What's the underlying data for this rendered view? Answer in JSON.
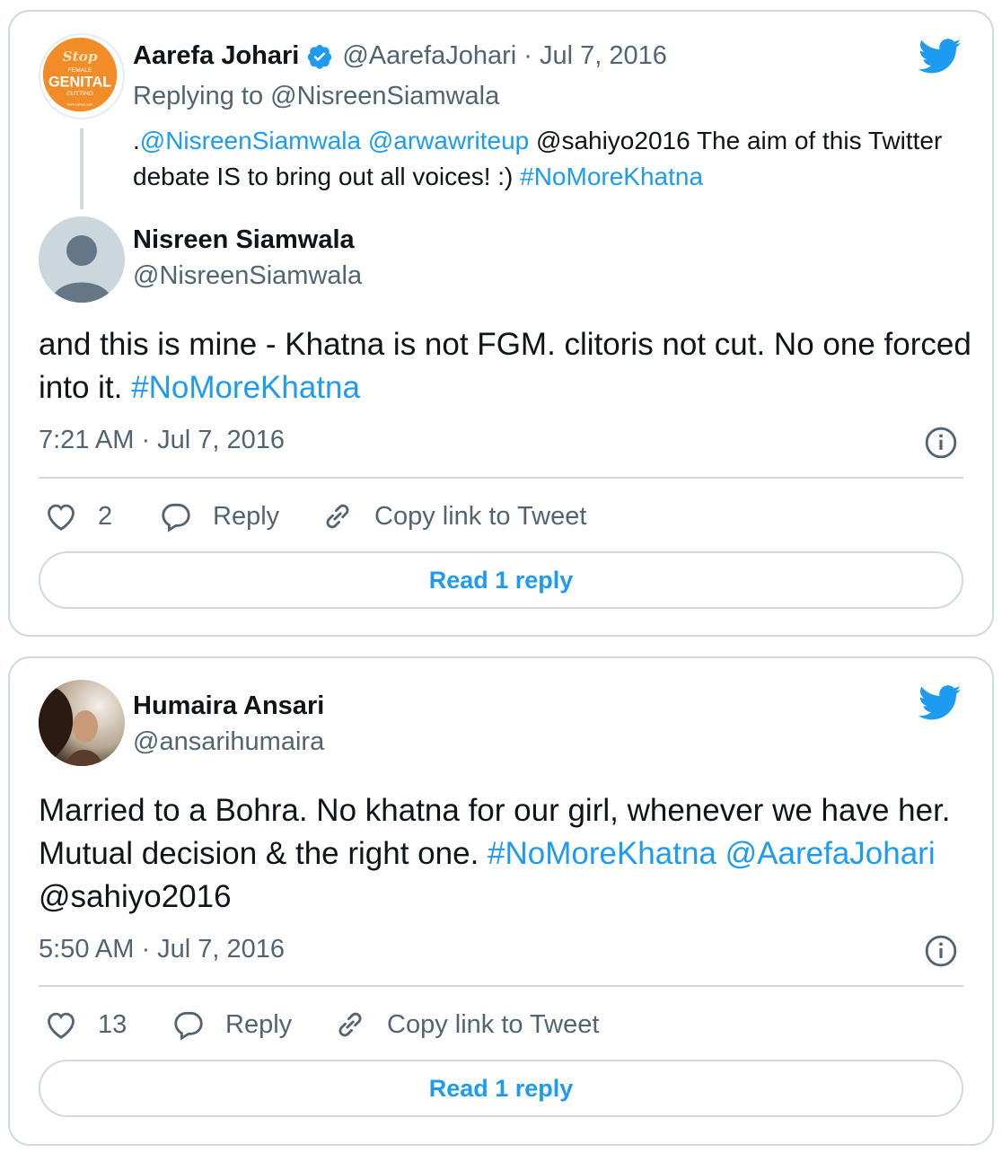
{
  "tweet1": {
    "quoted": {
      "avatar_text": {
        "line1": "Stop",
        "line2": "FEMALE",
        "line3": "GENITAL",
        "line4": "CUTTING",
        "line5": "www.sahiyo.com"
      },
      "name": "Aarefa Johari",
      "handle": "@AarefaJohari",
      "date": "· Jul 7, 2016",
      "replying_prefix": "Replying to ",
      "replying_handle": "@NisreenSiamwala",
      "text": {
        "lead": ".",
        "mention1": "@NisreenSiamwala",
        "mention2": "@arwawriteup",
        "rest": " @sahiyo2016 The aim of this Twitter debate IS to bring out all voices! :) ",
        "hashtag": "#NoMoreKhatna"
      }
    },
    "author": {
      "name": "Nisreen Siamwala",
      "handle": "@NisreenSiamwala"
    },
    "text": {
      "body": "and this is mine - Khatna is not FGM. clitoris not cut. No one forced into it. ",
      "hashtag": "#NoMoreKhatna"
    },
    "timestamp": "7:21 AM · Jul 7, 2016",
    "likes": "2",
    "reply_label": "Reply",
    "copy_label": "Copy link to Tweet",
    "read_reply_label": "Read 1 reply"
  },
  "tweet2": {
    "author": {
      "name": "Humaira Ansari",
      "handle": "@ansarihumaira"
    },
    "text": {
      "body": "Married to a Bohra. No khatna for our girl, whenever we have her. Mutual decision & the right one. ",
      "hashtag": "#NoMoreKhatna",
      "mention": "@AarefaJohari",
      "tail": " @sahiyo2016"
    },
    "timestamp": "5:50 AM · Jul 7, 2016",
    "likes": "13",
    "reply_label": "Reply",
    "copy_label": "Copy link to Tweet",
    "read_reply_label": "Read 1 reply"
  },
  "icons": {
    "twitter": "twitter-bird-icon",
    "verified": "verified-badge-icon",
    "like": "heart-icon",
    "reply": "speech-bubble-icon",
    "copy": "link-chain-icon",
    "info": "info-icon"
  },
  "colors": {
    "accent": "#1d9bf0",
    "muted": "#536471",
    "border": "#cfd9de",
    "stop_logo": "#f28c28"
  }
}
